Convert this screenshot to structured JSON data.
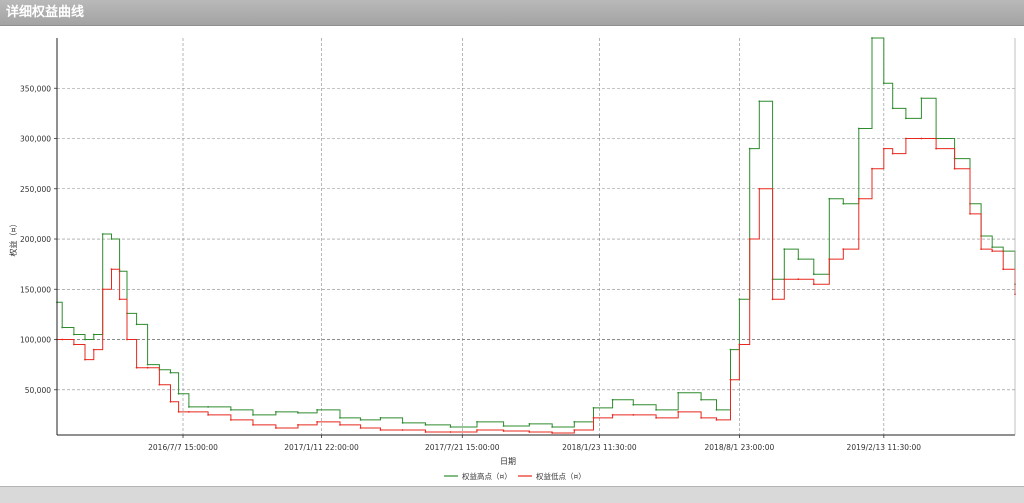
{
  "window": {
    "title": "详细权益曲线"
  },
  "chart_data": {
    "type": "line",
    "title": "",
    "xlabel": "日期",
    "ylabel": "权益（¤）",
    "ylim": [
      5000,
      400000
    ],
    "yticks": [
      50000,
      100000,
      150000,
      200000,
      250000,
      300000,
      350000
    ],
    "ytick_labels": [
      "50,000",
      "100,000",
      "150,000",
      "200,000",
      "250,000",
      "300,000",
      "350,000"
    ],
    "xlim": [
      "2016-01-18",
      "2019-08-10"
    ],
    "xticks": [
      "2016-07-07",
      "2017-01-11",
      "2017-07-21",
      "2018-01-23",
      "2018-08-01",
      "2019-02-13"
    ],
    "xtick_labels": [
      "2016/7/7 15:00:00",
      "2017/1/11 22:00:00",
      "2017/7/21 15:00:00",
      "2018/1/23 11:30:00",
      "2018/8/1 23:00:00",
      "2019/2/13 11:30:00"
    ],
    "grid": true,
    "legend_position": "bottom-center",
    "series": [
      {
        "name": "权益高点（¤）",
        "color": "#2e8b2e",
        "x": [
          "2016-01-18",
          "2016-01-25",
          "2016-02-10",
          "2016-02-25",
          "2016-03-08",
          "2016-03-20",
          "2016-04-01",
          "2016-04-12",
          "2016-04-22",
          "2016-05-05",
          "2016-05-20",
          "2016-06-05",
          "2016-06-20",
          "2016-07-01",
          "2016-07-15",
          "2016-08-10",
          "2016-09-10",
          "2016-10-10",
          "2016-11-10",
          "2016-12-10",
          "2017-01-05",
          "2017-02-05",
          "2017-03-05",
          "2017-04-01",
          "2017-05-01",
          "2017-06-01",
          "2017-07-05",
          "2017-08-10",
          "2017-09-15",
          "2017-10-20",
          "2017-11-20",
          "2017-12-20",
          "2018-01-15",
          "2018-02-10",
          "2018-03-10",
          "2018-04-10",
          "2018-05-10",
          "2018-06-10",
          "2018-07-01",
          "2018-07-20",
          "2018-08-01",
          "2018-08-15",
          "2018-08-28",
          "2018-09-15",
          "2018-10-01",
          "2018-10-20",
          "2018-11-10",
          "2018-12-01",
          "2018-12-20",
          "2019-01-10",
          "2019-01-28",
          "2019-02-13",
          "2019-02-25",
          "2019-03-15",
          "2019-04-05",
          "2019-04-25",
          "2019-05-20",
          "2019-06-10",
          "2019-06-25",
          "2019-07-10",
          "2019-07-25",
          "2019-08-10"
        ],
        "values": [
          137000,
          112000,
          105000,
          100000,
          105000,
          205000,
          200000,
          168000,
          126000,
          115000,
          75000,
          70000,
          67000,
          46000,
          33000,
          33000,
          30000,
          25000,
          28000,
          27000,
          30000,
          22000,
          20000,
          22000,
          17000,
          15000,
          13000,
          18000,
          14000,
          16000,
          13000,
          18000,
          32000,
          40000,
          35000,
          30000,
          47000,
          40000,
          30000,
          90000,
          140000,
          290000,
          337000,
          160000,
          190000,
          180000,
          165000,
          240000,
          235000,
          310000,
          400000,
          355000,
          330000,
          320000,
          340000,
          300000,
          280000,
          235000,
          203000,
          192000,
          188000,
          155000
        ]
      },
      {
        "name": "权益低点（¤）",
        "color": "#e8281e",
        "x": [
          "2016-01-18",
          "2016-01-25",
          "2016-02-10",
          "2016-02-25",
          "2016-03-08",
          "2016-03-20",
          "2016-04-01",
          "2016-04-12",
          "2016-04-22",
          "2016-05-05",
          "2016-05-20",
          "2016-06-05",
          "2016-06-20",
          "2016-07-01",
          "2016-07-15",
          "2016-08-10",
          "2016-09-10",
          "2016-10-10",
          "2016-11-10",
          "2016-12-10",
          "2017-01-05",
          "2017-02-05",
          "2017-03-05",
          "2017-04-01",
          "2017-05-01",
          "2017-06-01",
          "2017-07-05",
          "2017-08-10",
          "2017-09-15",
          "2017-10-20",
          "2017-11-20",
          "2017-12-20",
          "2018-01-15",
          "2018-02-10",
          "2018-03-10",
          "2018-04-10",
          "2018-05-10",
          "2018-06-10",
          "2018-07-01",
          "2018-07-20",
          "2018-08-01",
          "2018-08-15",
          "2018-08-28",
          "2018-09-15",
          "2018-10-01",
          "2018-10-20",
          "2018-11-10",
          "2018-12-01",
          "2018-12-20",
          "2019-01-10",
          "2019-01-28",
          "2019-02-13",
          "2019-02-25",
          "2019-03-15",
          "2019-04-05",
          "2019-04-25",
          "2019-05-20",
          "2019-06-10",
          "2019-06-25",
          "2019-07-10",
          "2019-07-25",
          "2019-08-10"
        ],
        "values": [
          100000,
          100000,
          95000,
          80000,
          90000,
          150000,
          170000,
          140000,
          100000,
          72000,
          72000,
          55000,
          38000,
          28000,
          28000,
          25000,
          20000,
          15000,
          12000,
          15000,
          18000,
          15000,
          12000,
          10000,
          10000,
          8000,
          8000,
          10000,
          9000,
          8000,
          7000,
          10000,
          22000,
          25000,
          25000,
          22000,
          28000,
          22000,
          20000,
          60000,
          95000,
          200000,
          250000,
          140000,
          160000,
          160000,
          155000,
          180000,
          190000,
          240000,
          270000,
          290000,
          285000,
          300000,
          300000,
          290000,
          270000,
          225000,
          190000,
          188000,
          170000,
          145000
        ]
      }
    ]
  }
}
